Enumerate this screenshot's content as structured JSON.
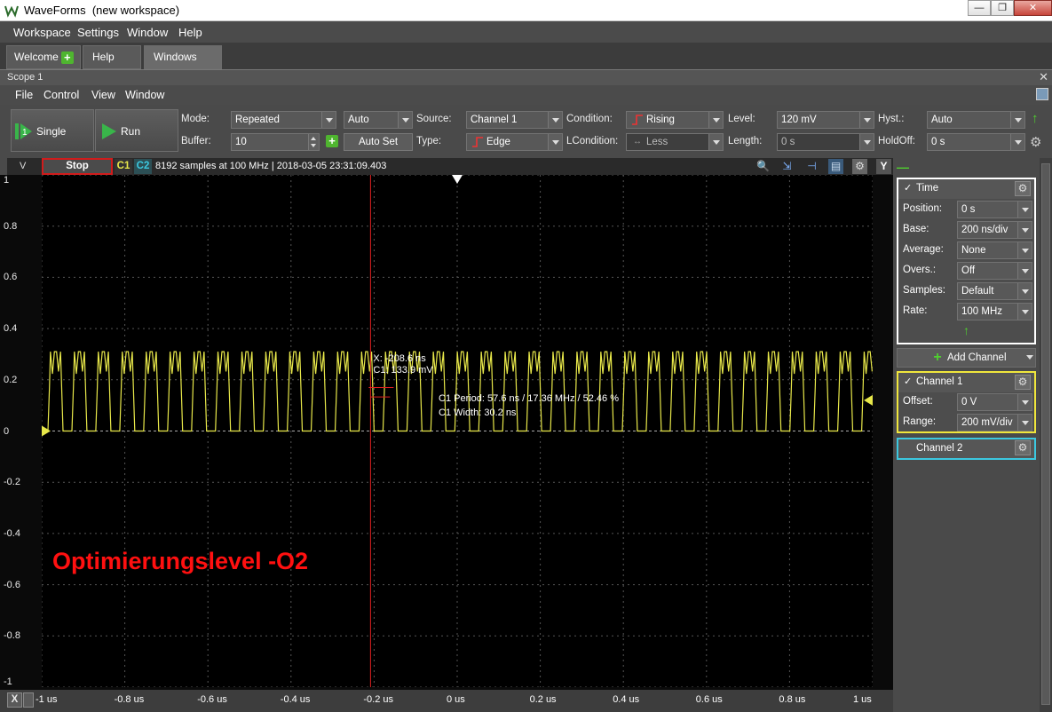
{
  "window": {
    "title": "WaveForms",
    "subtitle": "(new workspace)"
  },
  "menubar": [
    "Workspace",
    "Settings",
    "Window",
    "Help"
  ],
  "tabs": [
    {
      "label": "Welcome",
      "active": false
    },
    {
      "label": "Help",
      "active": false
    },
    {
      "label": "Windows",
      "active": true
    }
  ],
  "scope": {
    "title": "Scope 1",
    "menu": [
      "File",
      "Control",
      "View",
      "Window"
    ]
  },
  "toolbar": {
    "single_label": "Single",
    "run_label": "Run",
    "mode_label": "Mode:",
    "mode_value": "Repeated",
    "buffer_label": "Buffer:",
    "buffer_value": "10",
    "trigger_mode": "Auto",
    "autoset_label": "Auto Set",
    "source_label": "Source:",
    "source_value": "Channel 1",
    "type_label": "Type:",
    "type_value": "Edge",
    "condition_label": "Condition:",
    "condition_value": "Rising",
    "lcondition_label": "LCondition:",
    "lcondition_value": "Less",
    "level_label": "Level:",
    "level_value": "120 mV",
    "length_label": "Length:",
    "length_value": "0 s",
    "hyst_label": "Hyst.:",
    "hyst_value": "Auto",
    "holdoff_label": "HoldOff:",
    "holdoff_value": "0 s"
  },
  "plot_header": {
    "y_unit": "V",
    "stop_label": "Stop",
    "c1": "C1",
    "c2": "C2",
    "info": "8192 samples at 100 MHz | 2018-03-05 23:31:09.403",
    "y_button": "Y"
  },
  "cursor": {
    "x_text": "X: -208.6 ns",
    "c1_text": "C1: 133.9 mV"
  },
  "measurements": {
    "period": "C1 Period: 57.6 ns / 17.36 MHz / 52.46 %",
    "width": "C1 Width: 30.2 ns"
  },
  "overlay_caption": "Optimierungslevel -O2",
  "chart_data": {
    "type": "line",
    "x_ticks": [
      "-1 us",
      "-0.8 us",
      "-0.6 us",
      "-0.4 us",
      "-0.2 us",
      "0 us",
      "0.2 us",
      "0.4 us",
      "0.6 us",
      "0.8 us",
      "1 us"
    ],
    "y_ticks": [
      "1",
      "0.8",
      "0.6",
      "0.4",
      "0.2",
      "0",
      "-0.2",
      "-0.4",
      "-0.6",
      "-0.8",
      "-1"
    ],
    "xlim_us": [
      -1,
      1
    ],
    "ylim_v": [
      -1,
      1
    ],
    "series": [
      {
        "color": "#e8e84a",
        "period_ns": 57.6,
        "width_ns": 30.2,
        "high_v": 0.31,
        "low_v": 0.0,
        "overshoot_v": 0.31,
        "undershoot_v": 0.0
      }
    ],
    "cursor_x_us": -0.2086,
    "trigger_level_v": 0.12,
    "grid": true
  },
  "x_axis_button": "X",
  "right_panel": {
    "time": {
      "title": "Time",
      "rows": [
        {
          "label": "Position:",
          "value": "0 s"
        },
        {
          "label": "Base:",
          "value": "200 ns/div"
        },
        {
          "label": "Average:",
          "value": "None"
        },
        {
          "label": "Overs.:",
          "value": "Off"
        },
        {
          "label": "Samples:",
          "value": "Default"
        },
        {
          "label": "Rate:",
          "value": "100 MHz"
        }
      ]
    },
    "add_channel_label": "Add Channel",
    "channel1": {
      "title": "Channel 1",
      "rows": [
        {
          "label": "Offset:",
          "value": "0 V"
        },
        {
          "label": "Range:",
          "value": "200 mV/div"
        }
      ]
    },
    "channel2": {
      "title": "Channel 2"
    }
  },
  "colors": {
    "channel1": "#e8e84a",
    "channel2": "#3cc8e0",
    "cursor": "#e02020",
    "stop_border": "#d01c1c",
    "caption": "#ff1010"
  }
}
